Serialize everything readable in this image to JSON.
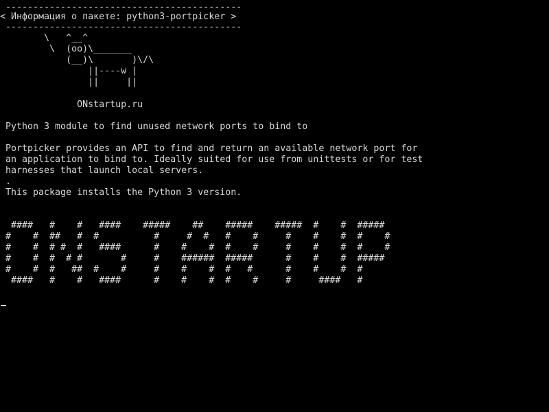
{
  "terminal": {
    "colors": {
      "background": "#000000",
      "foreground": "#d8d8d8"
    },
    "speech_bubble": {
      "top_border": " -------------------------------------------",
      "title": "< Информация о пакете: python3-portpicker >",
      "bottom_border": " -------------------------------------------"
    },
    "cow_art": [
      "        \\   ^__^",
      "         \\  (oo)\\_______",
      "            (__)\\       )\\/\\",
      "                ||----w |",
      "                ||     ||"
    ],
    "site": "              ONstartup.ru",
    "summary": " Python 3 module to find unused network ports to bind to",
    "description": [
      " Portpicker provides an API to find and return an available network port for",
      " an application to bind to. Ideally suited for use from unittests or for test",
      " harnesses that launch local servers.",
      " .",
      " This package installs the Python 3 version."
    ],
    "banner_art": [
      "  ####   #    #   ####    #####    ##    #####    #####  #    #  #####",
      " #    #  ##   #  #          #     #  #   #    #     #    #    #  #    #",
      " #    #  # #  #   ####      #    #    #  #    #     #    #    #  #    #",
      " #    #  #  # #       #     #    ######  #####      #    #    #  #####",
      " #    #  #   ##  #    #     #    #    #  #   #      #    #    #  #",
      "  ####   #    #   ####      #    #    #  #    #     #     ####   #"
    ],
    "cursor_icon": "text-cursor-icon"
  }
}
